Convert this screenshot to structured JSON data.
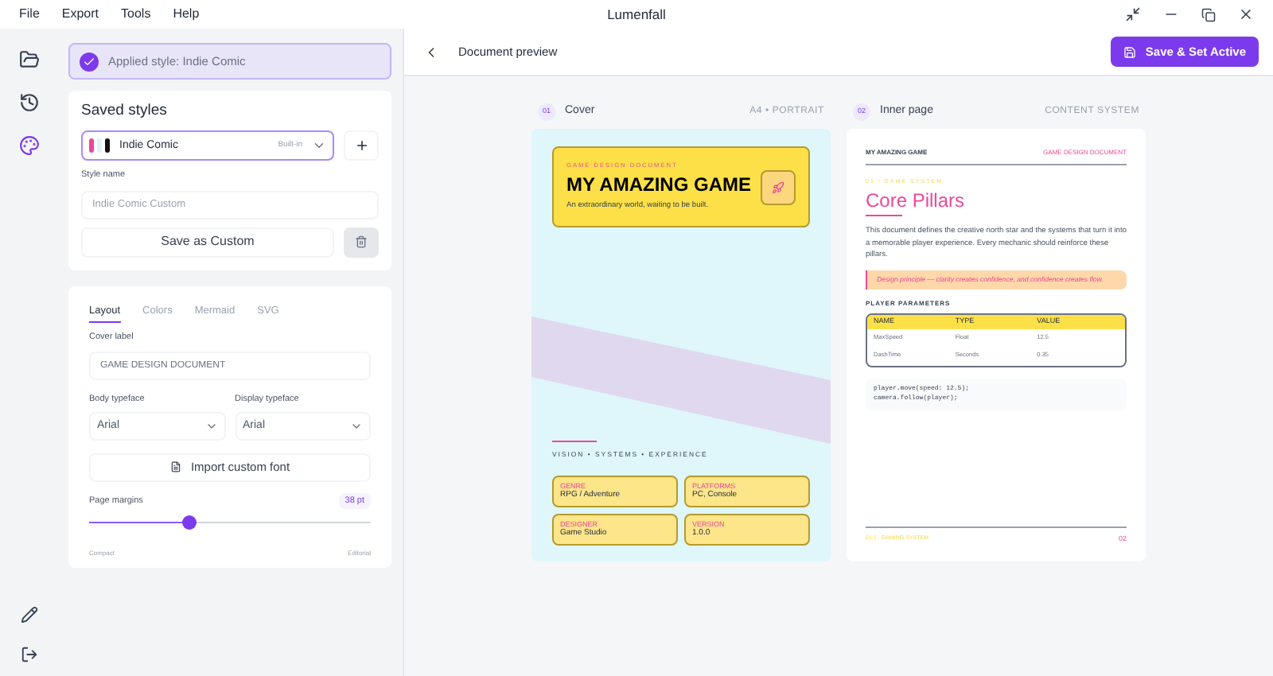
{
  "menu": [
    "File",
    "Export",
    "Tools",
    "Help"
  ],
  "window": {
    "title": "Lumenfall"
  },
  "rail": [
    {
      "selected": false
    },
    {
      "selected": false
    },
    {
      "selected": true
    }
  ],
  "toast": "Applied style: Indie Comic",
  "saved_styles": {
    "title": "Saved styles",
    "select": {
      "value": "Indie Comic",
      "badge": "Built-in",
      "swatches": [
        {
          "color": "#ec4899"
        },
        {
          "color": "#e0f2fe"
        },
        {
          "color": "#111111"
        }
      ]
    },
    "name_label": "Style name",
    "name_value": "Indie Comic Custom",
    "save": "Save as Custom"
  },
  "tabs": [
    {
      "label": "Layout",
      "selected": true
    },
    {
      "label": "Colors",
      "selected": false
    },
    {
      "label": "Mermaid",
      "selected": false
    },
    {
      "label": "SVG",
      "selected": false
    }
  ],
  "cover_label": {
    "label": "Cover label",
    "value": "GAME DESIGN DOCUMENT"
  },
  "typefaces": [
    {
      "label": "Body typeface",
      "value": "Arial"
    },
    {
      "label": "Display typeface",
      "value": "Arial"
    }
  ],
  "import_button": "Import custom font",
  "margins": {
    "label": "Page margins",
    "reading": "38 pt",
    "level": 0.355,
    "min": "Compact",
    "max": "Editorial"
  },
  "header": {
    "title": "Document preview",
    "save": "Save & Set Active"
  },
  "cover": {
    "number": "01",
    "name": "Cover",
    "meta": "A4 • PORTRAIT",
    "eyebrow": "GAME DESIGN DOCUMENT",
    "title": "MY AMAZING GAME",
    "subtitle": "An extraordinary world, waiting to be built.",
    "tagline": "VISION • SYSTEMS • EXPERIENCE",
    "facts": [
      {
        "label": "GENRE",
        "value": "RPG / Adventure"
      },
      {
        "label": "PLATFORMS",
        "value": "PC, Console"
      },
      {
        "label": "DESIGNER",
        "value": "Game Studio"
      },
      {
        "label": "VERSION",
        "value": "1.0.0"
      }
    ]
  },
  "inner": {
    "number": "02",
    "name": "Inner page",
    "meta": "CONTENT SYSTEM",
    "running_left": "MY AMAZING GAME",
    "running_right": "GAME DESIGN DOCUMENT",
    "eyebrow": "01 / GAME SYSTEM",
    "title": "Core Pillars",
    "paragraph": "This document defines the creative north star and the systems that turn it into a memorable player experience. Every mechanic should reinforce these pillars.",
    "callout": "Design principle — clarity creates confidence, and confidence creates flow.",
    "section": "PLAYER PARAMETERS",
    "table": {
      "columns": [
        "NAME",
        "TYPE",
        "VALUE"
      ],
      "rows": [
        [
          "MaxSpeed",
          "Float",
          "12.5"
        ],
        [
          "DashTime",
          "Seconds",
          "0.35"
        ]
      ]
    },
    "code": [
      "player.move(speed: 12.5);",
      "camera.follow(player);"
    ],
    "footer": "01.1 · GAMING SYSTEM",
    "page": "02"
  }
}
